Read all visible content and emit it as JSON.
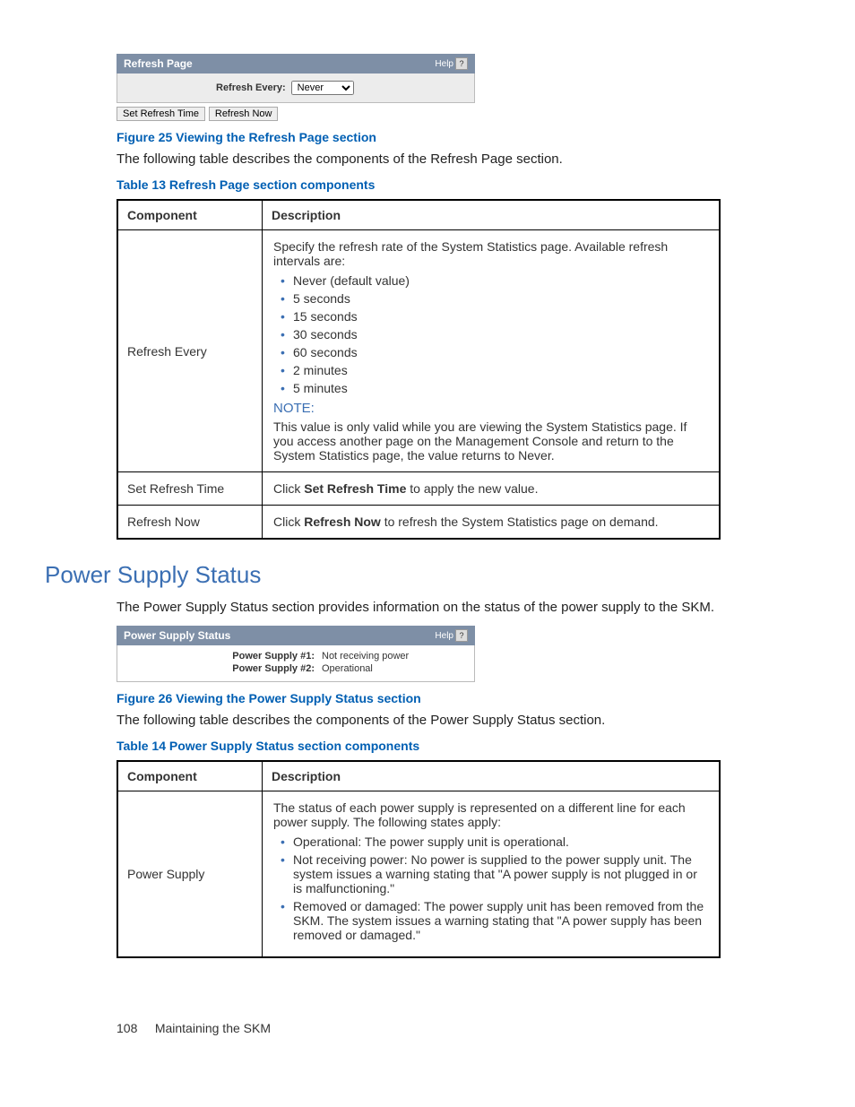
{
  "refresh_panel": {
    "title": "Refresh Page",
    "help": "Help",
    "refresh_every_label": "Refresh Every:",
    "refresh_every_value": "Never",
    "set_refresh_btn": "Set Refresh Time",
    "refresh_now_btn": "Refresh Now"
  },
  "fig25": "Figure 25 Viewing the Refresh Page section",
  "fig25_text": "The following table describes the components of the Refresh Page section.",
  "table13_caption": "Table 13 Refresh Page section components",
  "table13": {
    "header_component": "Component",
    "header_description": "Description",
    "row1_component": "Refresh Every",
    "row1_intro": "Specify the refresh rate of the System Statistics page. Available refresh intervals are:",
    "row1_bullets": {
      "0": "Never (default value)",
      "1": "5 seconds",
      "2": "15 seconds",
      "3": "30 seconds",
      "4": "60 seconds",
      "5": "2 minutes",
      "6": "5 minutes"
    },
    "row1_note_label": "NOTE:",
    "row1_note_text": "This value is only valid while you are viewing the System Statistics page. If you access another page on the Management Console and return to the System Statistics page, the value returns to Never.",
    "row2_component": "Set Refresh Time",
    "row2_desc_pre": "Click ",
    "row2_desc_bold": "Set Refresh Time",
    "row2_desc_post": " to apply the new value.",
    "row3_component": "Refresh Now",
    "row3_desc_pre": "Click ",
    "row3_desc_bold": "Refresh Now",
    "row3_desc_post": " to refresh the System Statistics page on demand."
  },
  "section_power": "Power Supply Status",
  "section_power_text": "The Power Supply Status section provides information on the status of the power supply to the SKM.",
  "psu_panel": {
    "title": "Power Supply Status",
    "help": "Help",
    "row1_label": "Power Supply #1:",
    "row1_value": "Not receiving power",
    "row2_label": "Power Supply #2:",
    "row2_value": "Operational"
  },
  "fig26": "Figure 26 Viewing the Power Supply Status section",
  "fig26_text": "The following table describes the components of the Power Supply Status section.",
  "table14_caption": "Table 14 Power Supply Status section components",
  "table14": {
    "header_component": "Component",
    "header_description": "Description",
    "row1_component": "Power Supply",
    "row1_intro": "The status of each power supply is represented on a different line for each power supply. The following states apply:",
    "row1_bullets": {
      "0": "Operational: The power supply unit is operational.",
      "1": "Not receiving power: No power is supplied to the power supply unit. The system issues a warning stating that \"A power supply is not plugged in or is malfunctioning.\"",
      "2": "Removed or damaged: The power supply unit has been removed from the SKM. The system issues a warning stating that \"A power supply has been removed or damaged.\""
    }
  },
  "footer_page": "108",
  "footer_title": "Maintaining the SKM"
}
